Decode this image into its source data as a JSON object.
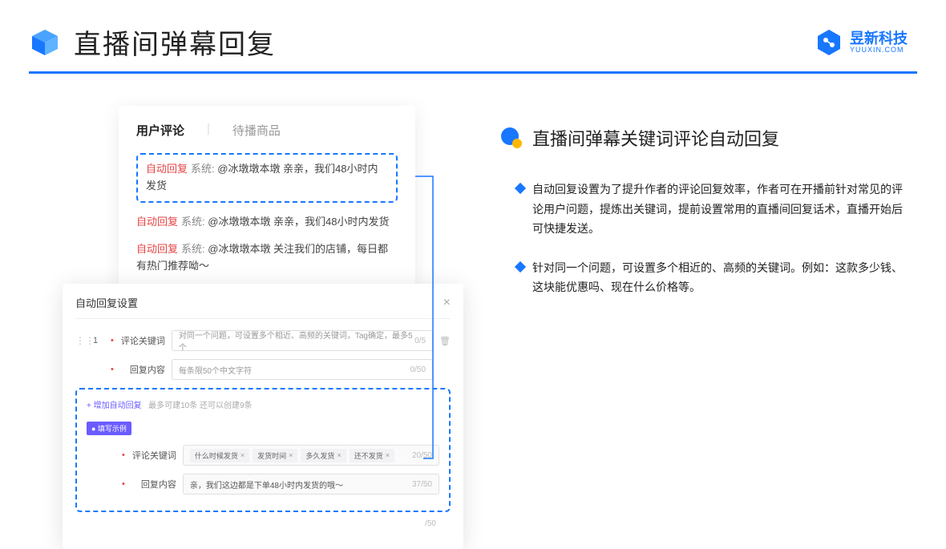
{
  "header": {
    "title": "直播间弹幕回复",
    "brand_name": "昱新科技",
    "brand_sub": "YUUXIN.COM"
  },
  "comments_panel": {
    "tab_active": "用户评论",
    "tab_inactive": "待播商品",
    "items": [
      {
        "tag": "自动回复",
        "sys": "系统:",
        "text": "@冰墩墩本墩 亲亲，我们48小时内发货",
        "highlight": true
      },
      {
        "tag": "自动回复",
        "sys": "系统:",
        "text": "@冰墩墩本墩 亲亲，我们48小时内发货",
        "highlight": false
      },
      {
        "tag": "自动回复",
        "sys": "系统:",
        "text": "@冰墩墩本墩 关注我们的店铺，每日都有热门推荐呦～",
        "highlight": false
      }
    ]
  },
  "settings": {
    "title": "自动回复设置",
    "row_num": "1",
    "keyword_label": "评论关键词",
    "keyword_placeholder": "对同一个问题，可设置多个相近、高频的关键词，Tag确定，最多5个",
    "keyword_count": "0/5",
    "reply_label": "回复内容",
    "reply_placeholder": "每条限50个中文字符",
    "reply_count": "0/50",
    "add_link": "+ 增加自动回复",
    "add_hint": "最多可建10条 还可以创建9条",
    "example_badge": "● 填写示例",
    "ex_keyword_label": "评论关键词",
    "ex_pills": [
      "什么时候发货",
      "发货时间",
      "多久发货",
      "还不发货"
    ],
    "ex_keyword_count": "20/50",
    "ex_reply_label": "回复内容",
    "ex_reply_value": "亲，我们这边都是下单48小时内发货的哦～",
    "ex_reply_count": "37/50",
    "outer_count": "/50"
  },
  "right": {
    "section_title": "直播间弹幕关键词评论自动回复",
    "bullets": [
      "自动回复设置为了提升作者的评论回复效率，作者可在开播前针对常见的评论用户问题，提炼出关键词，提前设置常用的直播间回复话术，直播开始后可快捷发送。",
      "针对同一个问题，可设置多个相近的、高频的关键词。例如：这款多少钱、这块能优惠吗、现在什么价格等。"
    ]
  }
}
